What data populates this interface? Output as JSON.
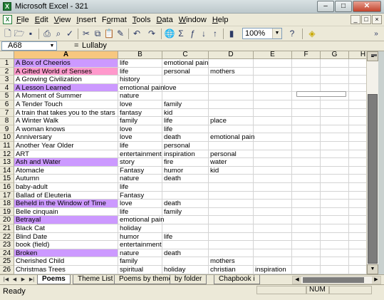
{
  "window": {
    "title": "Microsoft Excel - 321",
    "min": "–",
    "max": "□",
    "close": "✕"
  },
  "menu": {
    "items": [
      {
        "label": "File",
        "key": "F"
      },
      {
        "label": "Edit",
        "key": "E"
      },
      {
        "label": "View",
        "key": "V"
      },
      {
        "label": "Insert",
        "key": "I"
      },
      {
        "label": "Format",
        "key": "o"
      },
      {
        "label": "Tools",
        "key": "T"
      },
      {
        "label": "Data",
        "key": "D"
      },
      {
        "label": "Window",
        "key": "W"
      },
      {
        "label": "Help",
        "key": "H"
      }
    ],
    "doc_buttons": [
      "_",
      "□",
      "×"
    ]
  },
  "toolbar": {
    "icons": [
      "new-icon",
      "open-icon",
      "save-icon",
      "print-icon",
      "print-preview-icon",
      "spelling-icon",
      "cut-icon",
      "copy-icon",
      "paste-icon",
      "format-painter-icon",
      "undo-icon",
      "redo-icon",
      "hyperlink-icon",
      "autosum-icon",
      "function-icon",
      "sort-ascending-icon",
      "sort-descending-icon",
      "chart-wizard-icon",
      "drawing-icon"
    ],
    "zoom": "100%",
    "help_icon": "help-icon",
    "fill_color_icon": "fill-color-icon",
    "more": "»"
  },
  "formula_bar": {
    "name_box": "A68",
    "fx": "=",
    "value": "Lullaby"
  },
  "columns": [
    "A",
    "B",
    "C",
    "D",
    "E",
    "F",
    "G",
    "H"
  ],
  "selected_column": "A",
  "highlight_colors": {
    "purple": "#cc99ff",
    "pink": "#ff99cc"
  },
  "rows": [
    {
      "n": "1",
      "a": "A Box of Cheerios",
      "b": "life",
      "c": "emotional pain",
      "d": "",
      "e": "",
      "hl": "purple"
    },
    {
      "n": "2",
      "a": "A Gifted World of Senses",
      "b": "life",
      "c": "personal",
      "d": "mothers",
      "e": "",
      "hl": "pink"
    },
    {
      "n": "3",
      "a": "A Growing Civilization",
      "b": "history",
      "c": "",
      "d": "",
      "e": "",
      "hl": ""
    },
    {
      "n": "4",
      "a": "A Lesson Learned",
      "b": "emotional pain",
      "c": "love",
      "d": "",
      "e": "",
      "hl": "purple"
    },
    {
      "n": "5",
      "a": "A Moment of Summer",
      "b": "nature",
      "c": "",
      "d": "",
      "e": "",
      "hl": ""
    },
    {
      "n": "6",
      "a": "A Tender Touch",
      "b": "love",
      "c": "family",
      "d": "",
      "e": "",
      "hl": ""
    },
    {
      "n": "7",
      "a": "A train that takes you to the stars",
      "b": "fantasy",
      "c": "kid",
      "d": "",
      "e": "",
      "hl": ""
    },
    {
      "n": "8",
      "a": "A Winter Walk",
      "b": "family",
      "c": "life",
      "d": "place",
      "e": "",
      "hl": ""
    },
    {
      "n": "9",
      "a": "A woman knows",
      "b": "love",
      "c": "life",
      "d": "",
      "e": "",
      "hl": ""
    },
    {
      "n": "10",
      "a": "Anniversary",
      "b": "love",
      "c": "death",
      "d": "emotional pain",
      "e": "",
      "hl": ""
    },
    {
      "n": "11",
      "a": "Another Year Older",
      "b": "life",
      "c": "personal",
      "d": "",
      "e": "",
      "hl": ""
    },
    {
      "n": "12",
      "a": "ART",
      "b": "entertainment",
      "c": "inspiration",
      "d": "personal",
      "e": "",
      "hl": ""
    },
    {
      "n": "13",
      "a": "Ash and Water",
      "b": "story",
      "c": "fire",
      "d": "water",
      "e": "",
      "hl": "purple"
    },
    {
      "n": "14",
      "a": "Atomacle",
      "b": "Fantasy",
      "c": "humor",
      "d": "kid",
      "e": "",
      "hl": ""
    },
    {
      "n": "15",
      "a": "Autumn",
      "b": "nature",
      "c": "death",
      "d": "",
      "e": "",
      "hl": ""
    },
    {
      "n": "16",
      "a": "baby-adult",
      "b": "life",
      "c": "",
      "d": "",
      "e": "",
      "hl": ""
    },
    {
      "n": "17",
      "a": "Ballad of Eleuteria",
      "b": "Fantasy",
      "c": "",
      "d": "",
      "e": "",
      "hl": ""
    },
    {
      "n": "18",
      "a": "Beheld in the Window of Time",
      "b": "love",
      "c": "death",
      "d": "",
      "e": "",
      "hl": "purple"
    },
    {
      "n": "19",
      "a": "Belle cinquain",
      "b": "life",
      "c": "family",
      "d": "",
      "e": "",
      "hl": ""
    },
    {
      "n": "20",
      "a": "Betrayal",
      "b": "emotional pain",
      "c": "",
      "d": "",
      "e": "",
      "hl": "purple"
    },
    {
      "n": "21",
      "a": "Black Cat",
      "b": "holiday",
      "c": "",
      "d": "",
      "e": "",
      "hl": ""
    },
    {
      "n": "22",
      "a": "Blind Date",
      "b": "humor",
      "c": "life",
      "d": "",
      "e": "",
      "hl": ""
    },
    {
      "n": "23",
      "a": "book (field)",
      "b": "entertainment",
      "c": "",
      "d": "",
      "e": "",
      "hl": ""
    },
    {
      "n": "24",
      "a": "Broken",
      "b": "nature",
      "c": "death",
      "d": "",
      "e": "",
      "hl": "purple"
    },
    {
      "n": "25",
      "a": "Cherished Child",
      "b": "family",
      "c": "",
      "d": "mothers",
      "e": "",
      "hl": ""
    },
    {
      "n": "26",
      "a": "Christmas Trees",
      "b": "spiritual",
      "c": "holiday",
      "d": "christian",
      "e": "inspiration",
      "hl": ""
    }
  ],
  "tabs": [
    "Poems",
    "Theme List",
    "Poems by theme",
    "by folder",
    "Chapbook i"
  ],
  "active_tab": "Poems",
  "status": {
    "ready": "Ready",
    "num": "NUM"
  }
}
